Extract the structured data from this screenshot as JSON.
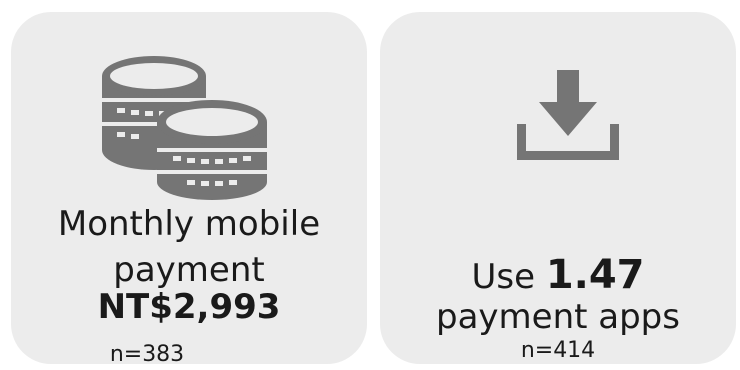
{
  "cards": {
    "payment": {
      "icon": "coins-icon",
      "line1": "Monthly mobile",
      "line2": "payment",
      "amount": "NT$2,993",
      "sample": "n=383"
    },
    "apps": {
      "icon": "download-icon",
      "prefix": "Use ",
      "number": "1.47",
      "line2": "payment apps",
      "sample": "n=414"
    }
  },
  "colors": {
    "card_background": "#ececec",
    "icon": "#757575",
    "text": "#1a1a1a"
  }
}
